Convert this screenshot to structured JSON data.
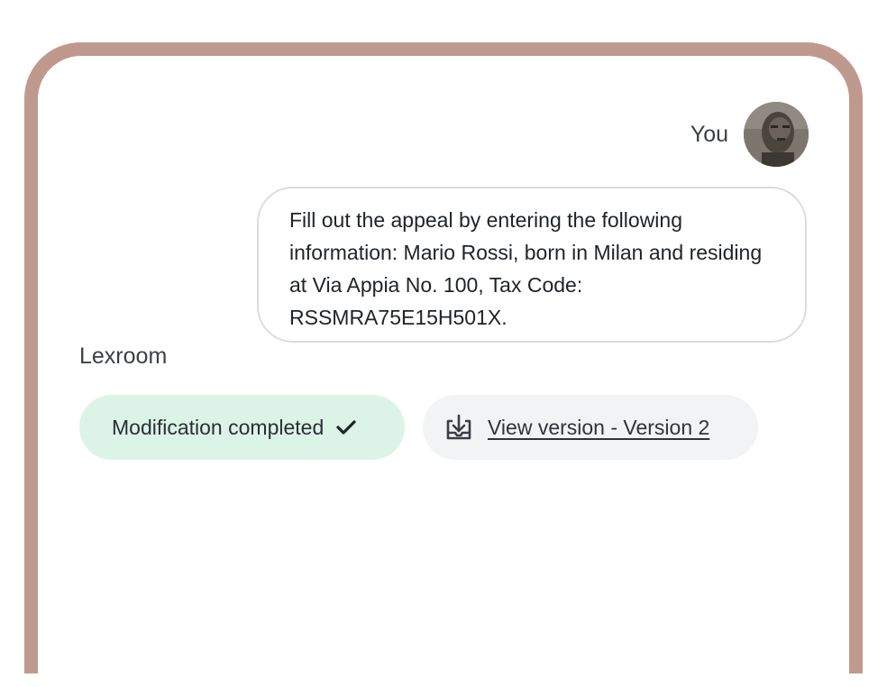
{
  "user": {
    "name": "You",
    "avatar_icon": "user-avatar-photo"
  },
  "message": {
    "text": "Fill out the appeal by entering the following information: Mario Rossi, born in Milan and residing at Via Appia No. 100, Tax Code: RSSMRA75E15H501X."
  },
  "assistant": {
    "name": "Lexroom"
  },
  "status": {
    "label": "Modification completed",
    "icon": "checkmark-icon",
    "color": "#dcf3e7"
  },
  "version_link": {
    "label": "View version - Version 2",
    "icon": "download-tray-icon"
  },
  "colors": {
    "frame": "#c0998e",
    "success_bg": "#dcf3e7",
    "neutral_bg": "#f2f3f5"
  }
}
